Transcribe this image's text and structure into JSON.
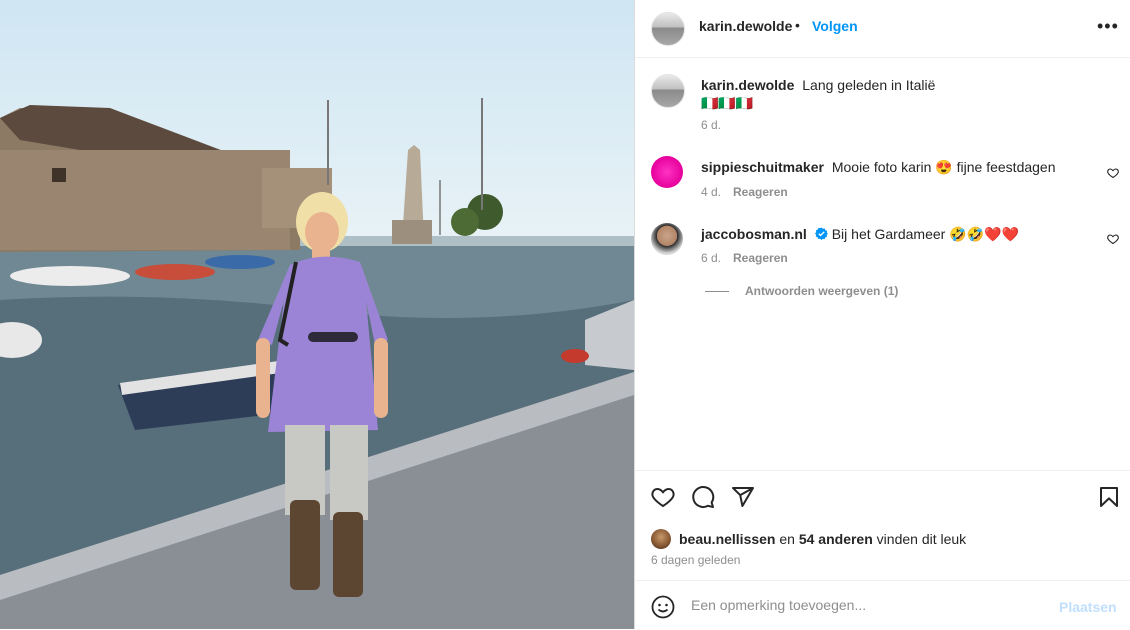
{
  "post": {
    "author": "karin.dewolde",
    "follow_label": "Volgen",
    "dot": "•",
    "more_label": "•••",
    "caption_text": "Lang geleden in Italië",
    "caption_flags": "🇮🇹🇮🇹🇮🇹",
    "caption_age": "6 d."
  },
  "comments": [
    {
      "user": "sippieschuitmaker",
      "text": "Mooie foto karin 😍 fijne feestdagen",
      "age": "4 d.",
      "reply_label": "Reageren"
    },
    {
      "user": "jaccobosman.nl",
      "verified": true,
      "text": "Bij het Gardameer 🤣🤣❤️❤️",
      "age": "6 d.",
      "reply_label": "Reageren"
    }
  ],
  "view_replies_label": "Antwoorden weergeven (1)",
  "likes": {
    "first_user": "beau.nellissen",
    "connector": "en",
    "others": "54 anderen",
    "suffix": "vinden dit leuk"
  },
  "posted_ago": "6 dagen geleden",
  "comment_input": {
    "placeholder": "Een opmerking toevoegen...",
    "value": ""
  },
  "post_button_label": "Plaatsen",
  "icons": [
    "heart-icon",
    "comment-icon",
    "share-icon",
    "bookmark-icon",
    "emoji-icon",
    "verified-badge-icon"
  ],
  "colors": {
    "link": "#0095f6",
    "muted": "#8e8e8e",
    "post_disabled": "#c0dffd"
  }
}
